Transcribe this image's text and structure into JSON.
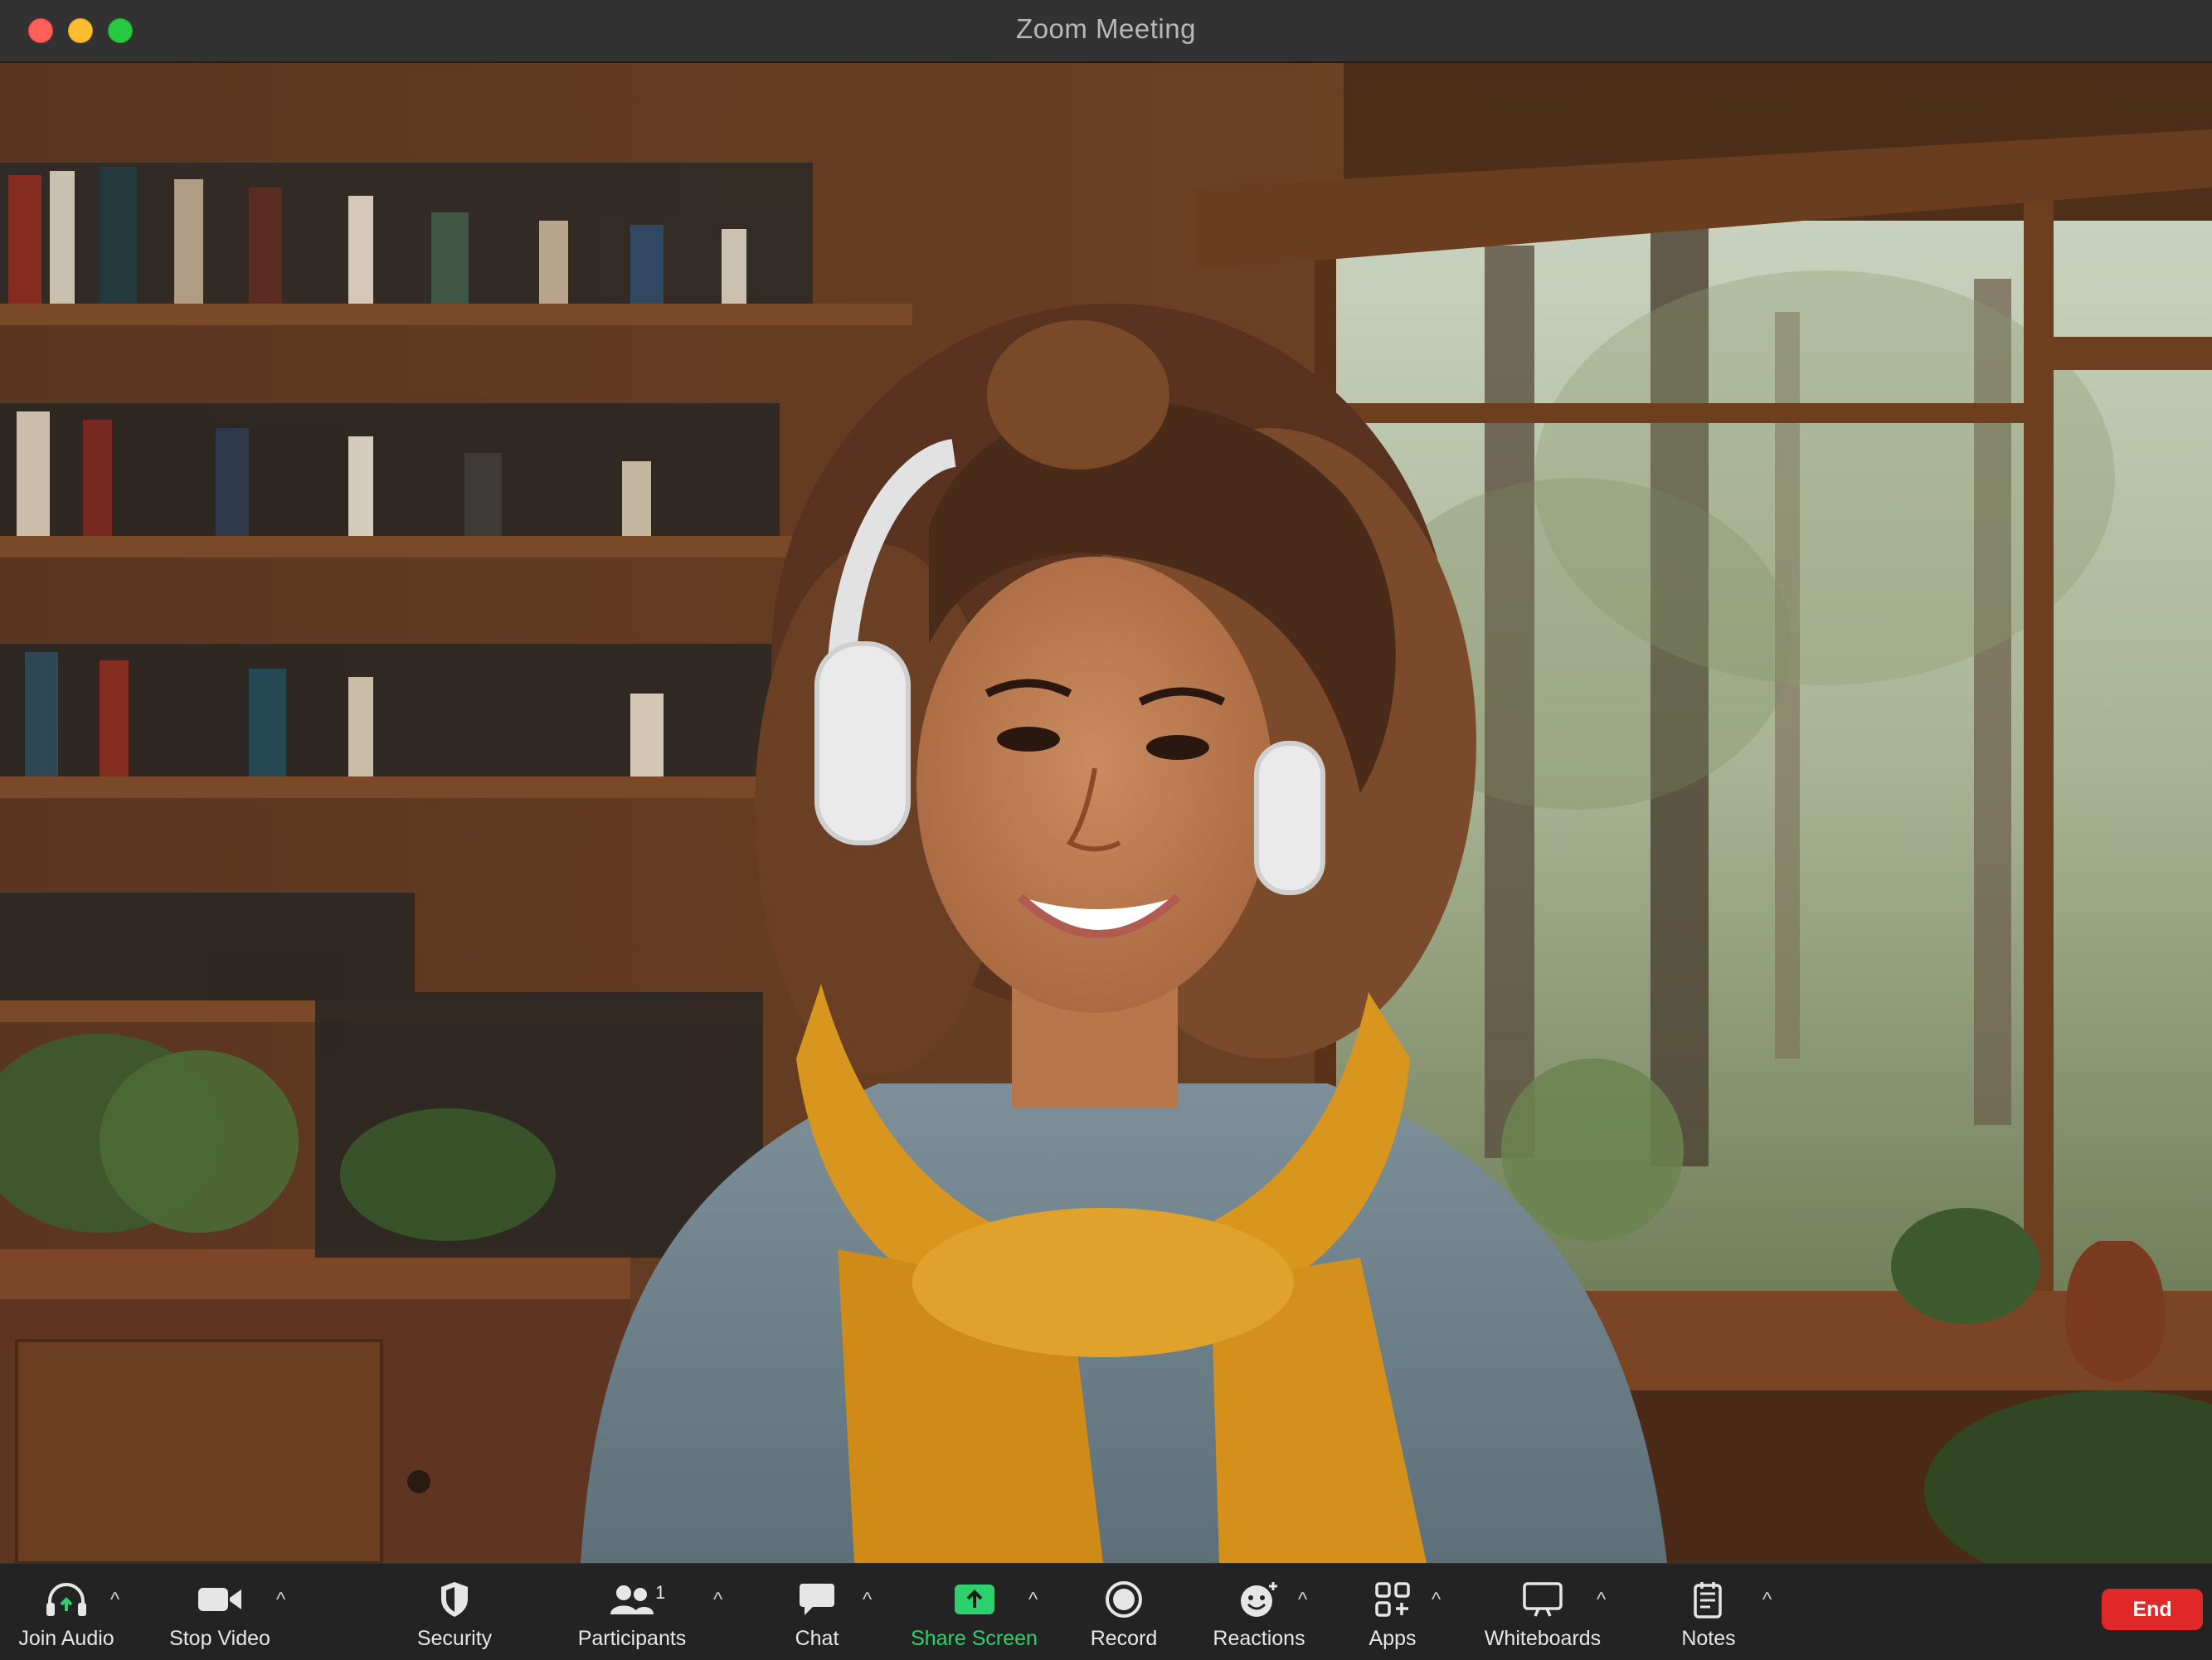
{
  "window": {
    "title": "Zoom Meeting"
  },
  "toolbar": {
    "join_audio": "Join Audio",
    "stop_video": "Stop Video",
    "security": "Security",
    "participants": "Participants",
    "participants_count": "1",
    "chat": "Chat",
    "share_screen": "Share Screen",
    "record": "Record",
    "reactions": "Reactions",
    "apps": "Apps",
    "whiteboards": "Whiteboards",
    "notes": "Notes",
    "end": "End",
    "caret": "^"
  },
  "icons": {
    "join_audio": "headphones-icon",
    "stop_video": "video-camera-icon",
    "security": "shield-icon",
    "participants": "people-icon",
    "chat": "chat-bubble-icon",
    "share_screen": "share-screen-icon",
    "record": "record-icon",
    "reactions": "emoji-icon",
    "apps": "apps-icon",
    "whiteboards": "whiteboard-icon",
    "notes": "notes-icon"
  },
  "colors": {
    "share_screen_accent": "#2ed06e",
    "end_button": "#e02828",
    "toolbar_bg": "#232323",
    "titlebar_bg": "#323232"
  }
}
